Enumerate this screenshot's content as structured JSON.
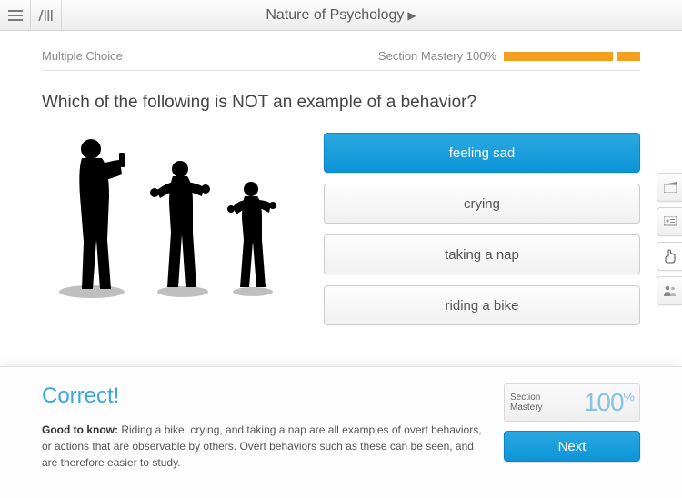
{
  "header": {
    "title": "Nature of Psychology"
  },
  "meta": {
    "type_label": "Multiple Choice",
    "mastery_label": "Section Mastery",
    "mastery_percent": "100%"
  },
  "question": "Which of the following is NOT an example of a behavior?",
  "answers": [
    {
      "label": "feeling sad",
      "selected": true
    },
    {
      "label": "crying",
      "selected": false
    },
    {
      "label": "taking a nap",
      "selected": false
    },
    {
      "label": "riding a bike",
      "selected": false
    }
  ],
  "feedback": {
    "title": "Correct!",
    "lead": "Good to know:",
    "body": "Riding a bike, crying, and taking a nap are all examples of overt behaviors, or actions that are observable by others. Overt behaviors such as these can be seen, and are therefore easier to study.",
    "mastery_label_a": "Section",
    "mastery_label_b": "Mastery",
    "mastery_value": "100",
    "mastery_unit": "%",
    "next_label": "Next"
  }
}
